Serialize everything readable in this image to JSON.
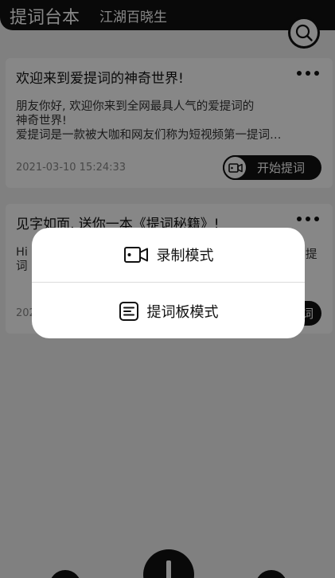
{
  "header": {
    "title": "提词台本",
    "subtitle": "江湖百晓生"
  },
  "cards": [
    {
      "title": "欢迎来到爱提词的神奇世界!",
      "body_lines": [
        "朋友你好, 欢迎你来到全网最具人气的爱提词的",
        "神奇世界!",
        "爱提词是一款被大咖和网友们称为短视频第一提词…"
      ],
      "date": "2021-03-10 15:24:33",
      "button_label": "开始提词"
    },
    {
      "title": "见字如面, 送你一本《提词秘籍》!",
      "body_lines": [
        "Hi",
        "词",
        ""
      ],
      "body_right": "提",
      "date": "202",
      "button_label": "词"
    }
  ],
  "sheet": {
    "items": [
      {
        "label": "录制模式",
        "icon": "video-camera-icon"
      },
      {
        "label": "提词板模式",
        "icon": "teleprompter-board-icon"
      }
    ]
  }
}
